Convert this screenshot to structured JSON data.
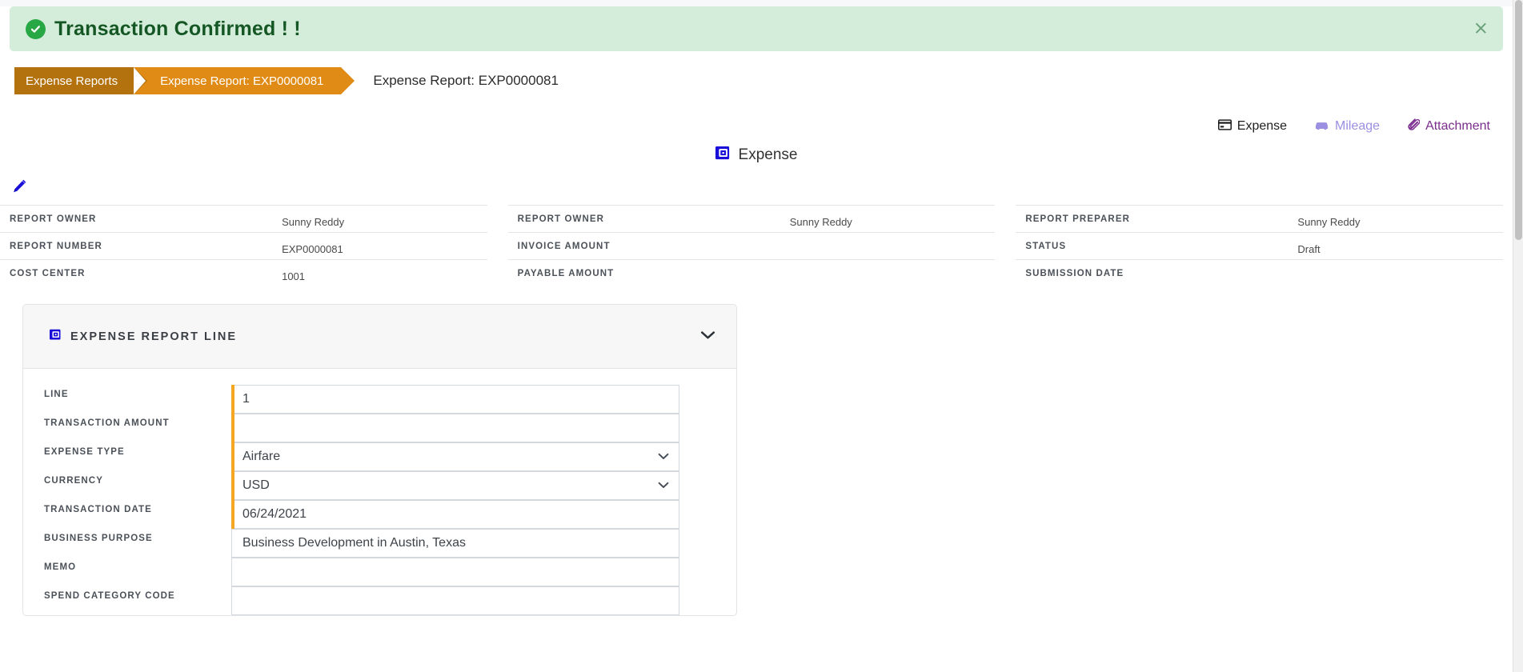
{
  "banner": {
    "icon": "check-circle-icon",
    "message": "Transaction Confirmed ! !",
    "close_label": "×",
    "bg_color": "#d4edda",
    "text_color": "#155724",
    "icon_color": "#28a745"
  },
  "breadcrumb": {
    "items": [
      {
        "label": "Expense Reports",
        "color": "#b4720f"
      },
      {
        "label": "Expense Report: EXP0000081",
        "color": "#e08b15"
      }
    ],
    "page_title": "Expense Report: EXP0000081"
  },
  "actions": [
    {
      "label": "Expense",
      "icon": "credit-card-icon",
      "color": "#1f1f1f",
      "active": true
    },
    {
      "label": "Mileage",
      "icon": "car-icon",
      "color": "#9a8fe0",
      "active": false
    },
    {
      "label": "Attachment",
      "icon": "paperclip-icon",
      "color": "#7b2d8e",
      "active": false
    }
  ],
  "center_header": {
    "icon": "expense-app-icon",
    "label": "Expense"
  },
  "edit": {
    "icon": "pencil-icon"
  },
  "summary": {
    "columns": [
      {
        "rows": [
          {
            "label": "REPORT OWNER",
            "value": "Sunny Reddy"
          },
          {
            "label": "REPORT NUMBER",
            "value": "EXP0000081"
          },
          {
            "label": "COST CENTER",
            "value": "1001"
          }
        ]
      },
      {
        "rows": [
          {
            "label": "REPORT OWNER",
            "value": "Sunny Reddy"
          },
          {
            "label": "INVOICE AMOUNT",
            "value": ""
          },
          {
            "label": "PAYABLE AMOUNT",
            "value": ""
          }
        ]
      },
      {
        "rows": [
          {
            "label": "REPORT PREPARER",
            "value": "Sunny Reddy"
          },
          {
            "label": "STATUS",
            "value": "Draft"
          },
          {
            "label": "SUBMISSION DATE",
            "value": ""
          }
        ]
      }
    ]
  },
  "line_card": {
    "icon": "expense-app-icon",
    "title": "EXPENSE REPORT LINE",
    "collapse_icon": "chevron-down-icon",
    "fields": [
      {
        "label": "LINE",
        "value": "1",
        "type": "text",
        "required": true
      },
      {
        "label": "TRANSACTION AMOUNT",
        "value": "",
        "type": "text",
        "required": true
      },
      {
        "label": "EXPENSE TYPE",
        "value": "Airfare",
        "type": "select",
        "required": true
      },
      {
        "label": "CURRENCY",
        "value": "USD",
        "type": "select",
        "required": true
      },
      {
        "label": "TRANSACTION DATE",
        "value": "06/24/2021",
        "type": "text",
        "required": true
      },
      {
        "label": "BUSINESS PURPOSE",
        "value": "Business Development in Austin, Texas",
        "type": "text",
        "required": false
      },
      {
        "label": "MEMO",
        "value": "",
        "type": "text",
        "required": false
      },
      {
        "label": "SPEND CATEGORY CODE",
        "value": "",
        "type": "text",
        "required": false
      }
    ]
  },
  "colors": {
    "required_marker": "#f5a623",
    "breadcrumb_active": "#e08b15",
    "brand_blue": "#1a0fd8"
  }
}
